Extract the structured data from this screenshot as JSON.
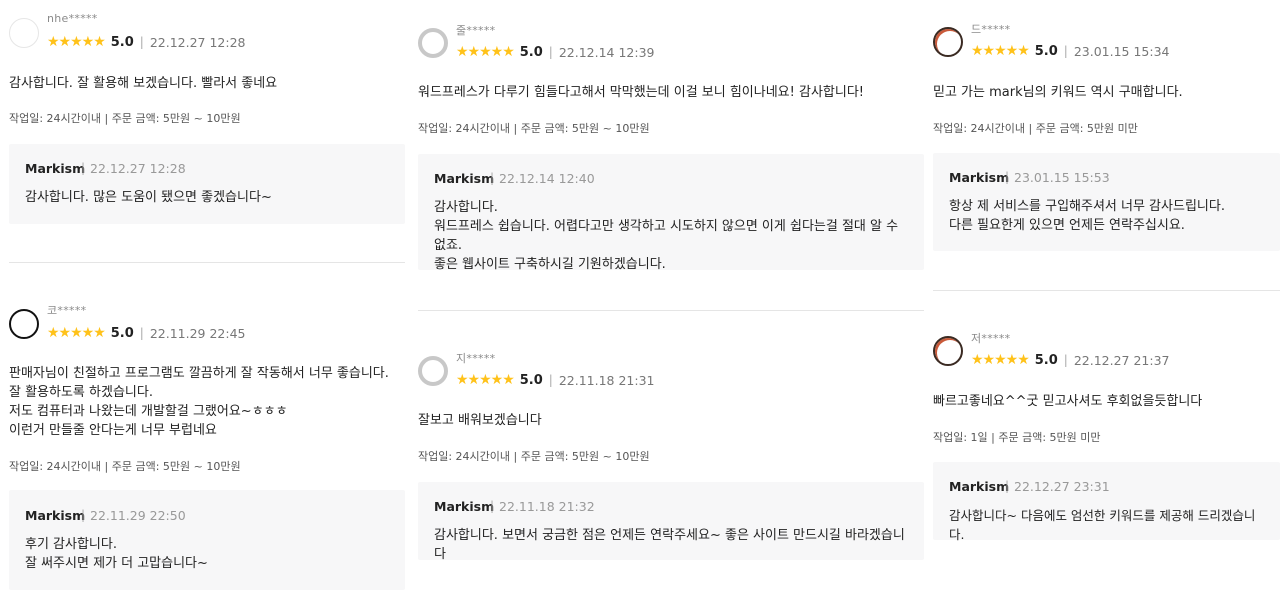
{
  "reviews": [
    {
      "user": "nhe*****",
      "stars": "★★★★★",
      "score": "5.0",
      "date": "22.12.27 12:28",
      "text": "감사합니다. 잘 활용해 보겠습니다. 빨라서 좋네요",
      "meta": "작업일: 24시간이내 | 주문 금액: 5만원 ~ 10만원",
      "reply": {
        "author": "Markism",
        "date": "22.12.27 12:28",
        "text": "감사합니다. 많은 도움이 됐으면 좋겠습니다~"
      }
    },
    {
      "user": "코*****",
      "stars": "★★★★★",
      "score": "5.0",
      "date": "22.11.29 22:45",
      "text": "판매자님이 친절하고 프로그램도 깔끔하게 잘 작동해서 너무 좋습니다.\n잘 활용하도록 하겠습니다.\n저도 컴퓨터과 나왔는데 개발할걸 그랬어요~ㅎㅎㅎ\n이런거 만들줄 안다는게 너무 부럽네요",
      "meta": "작업일: 24시간이내 | 주문 금액: 5만원 ~ 10만원",
      "reply": {
        "author": "Markism",
        "date": "22.11.29 22:50",
        "text": "후기 감사합니다.\n잘 써주시면 제가 더 고맙습니다~"
      }
    },
    {
      "user": "줄*****",
      "stars": "★★★★★",
      "score": "5.0",
      "date": "22.12.14 12:39",
      "text": "워드프레스가 다루기 힘들다고해서 막막했는데 이걸 보니 힘이나네요! 감사합니다!",
      "meta": "작업일: 24시간이내 | 주문 금액: 5만원 ~ 10만원",
      "reply": {
        "author": "Markism",
        "date": "22.12.14 12:40",
        "text": "감사합니다.\n워드프레스 쉽습니다. 어렵다고만 생각하고 시도하지 않으면 이게 쉽다는걸 절대 알 수 없죠.\n좋은 웹사이트 구축하시길 기원하겠습니다."
      }
    },
    {
      "user": "지*****",
      "stars": "★★★★★",
      "score": "5.0",
      "date": "22.11.18 21:31",
      "text": "잘보고 배워보겠습니다",
      "meta": "작업일: 24시간이내 | 주문 금액: 5만원 ~ 10만원",
      "reply": {
        "author": "Markism",
        "date": "22.11.18 21:32",
        "text": "감사합니다. 보면서 궁금한 점은 언제든 연락주세요~ 좋은 사이트 만드시길 바라겠습니다"
      }
    },
    {
      "user": "드*****",
      "stars": "★★★★★",
      "score": "5.0",
      "date": "23.01.15 15:34",
      "text": "믿고 가는 mark님의 키워드 역시 구매합니다.",
      "meta": "작업일: 24시간이내 | 주문 금액: 5만원 미만",
      "reply": {
        "author": "Markism",
        "date": "23.01.15 15:53",
        "text": "항상 제 서비스를 구입해주셔서 너무 감사드립니다.\n다른 필요한게 있으면 언제든 연락주십시요."
      }
    },
    {
      "user": "저*****",
      "stars": "★★★★★",
      "score": "5.0",
      "date": "22.12.27 21:37",
      "text": "빠르고좋네요^^굿 믿고사셔도 후회없을듯합니다",
      "meta": "작업일: 1일 | 주문 금액: 5만원 미만",
      "reply": {
        "author": "Markism",
        "date": "22.12.27 23:31",
        "text": "감사합니다~ 다음에도 엄선한 키워드를 제공해 드리겠습니다."
      }
    }
  ],
  "avatar_types": [
    "empty",
    "black",
    "gray",
    "gray",
    "photo",
    "photo"
  ],
  "colors": {
    "star": "#ffc21a",
    "reply_bg": "#f7f7f8",
    "divider": "#e5e5e5"
  }
}
